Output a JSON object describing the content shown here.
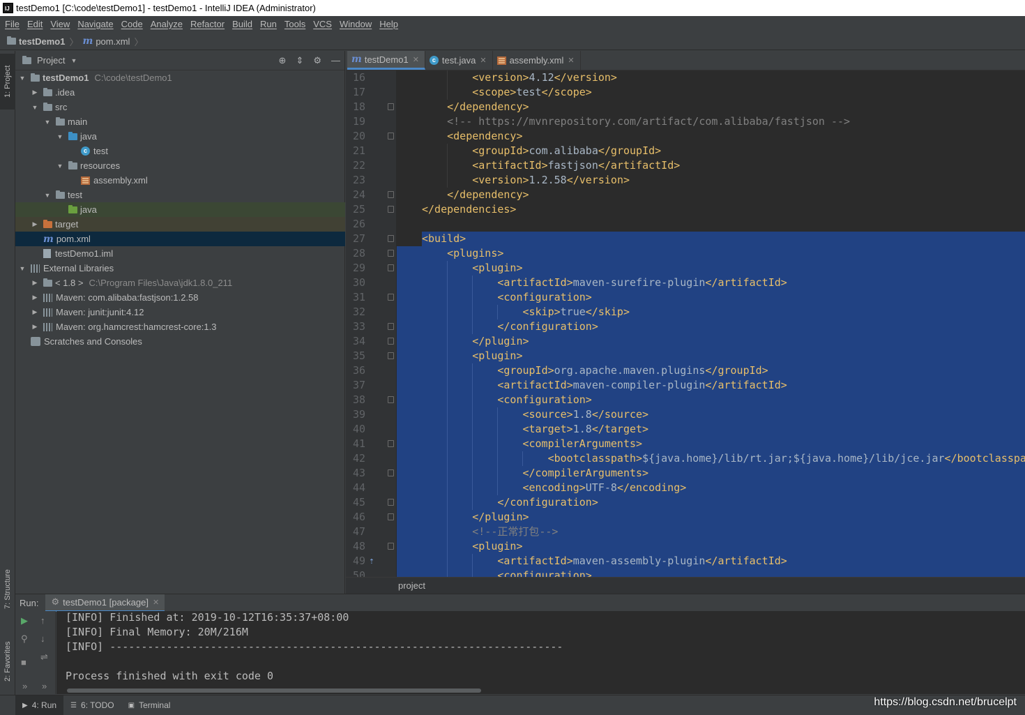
{
  "window": {
    "title": "testDemo1 [C:\\code\\testDemo1] - testDemo1 - IntelliJ IDEA (Administrator)",
    "app_icon": "IJ"
  },
  "menu": [
    "File",
    "Edit",
    "View",
    "Navigate",
    "Code",
    "Analyze",
    "Refactor",
    "Build",
    "Run",
    "Tools",
    "VCS",
    "Window",
    "Help"
  ],
  "breadcrumb": {
    "project": "testDemo1",
    "file": "pom.xml",
    "file_icon": "m"
  },
  "left_stripe": {
    "project_tab": "1: Project",
    "structure_tab": "7: Structure",
    "favorites_tab": "2: Favorites"
  },
  "project_panel": {
    "title": "Project",
    "tree": [
      {
        "label": "testDemo1",
        "extra": "C:\\code\\testDemo1",
        "arrow": "▼",
        "icon": "folder"
      },
      {
        "label": ".idea",
        "arrow": "▶",
        "icon": "folder"
      },
      {
        "label": "src",
        "arrow": "▼",
        "icon": "folder"
      },
      {
        "label": "main",
        "arrow": "▼",
        "icon": "folder"
      },
      {
        "label": "java",
        "arrow": "▼",
        "icon": "folder-blue"
      },
      {
        "label": "test",
        "arrow": "",
        "icon": "java-class"
      },
      {
        "label": "resources",
        "arrow": "▼",
        "icon": "folder-res"
      },
      {
        "label": "assembly.xml",
        "arrow": "",
        "icon": "xml"
      },
      {
        "label": "test",
        "arrow": "▼",
        "icon": "folder"
      },
      {
        "label": "java",
        "arrow": "",
        "icon": "folder-green"
      },
      {
        "label": "target",
        "arrow": "▶",
        "icon": "folder-orange"
      },
      {
        "label": "pom.xml",
        "arrow": "",
        "icon": "maven"
      },
      {
        "label": "testDemo1.iml",
        "arrow": "",
        "icon": "iml"
      },
      {
        "label": "External Libraries",
        "arrow": "▼",
        "icon": "lib"
      },
      {
        "label": "< 1.8 >",
        "extra": "C:\\Program Files\\Java\\jdk1.8.0_211",
        "arrow": "▶",
        "icon": "folder"
      },
      {
        "label": "Maven: com.alibaba:fastjson:1.2.58",
        "arrow": "▶",
        "icon": "lib"
      },
      {
        "label": "Maven: junit:junit:4.12",
        "arrow": "▶",
        "icon": "lib"
      },
      {
        "label": "Maven: org.hamcrest:hamcrest-core:1.3",
        "arrow": "▶",
        "icon": "lib"
      },
      {
        "label": "Scratches and Consoles",
        "arrow": "",
        "icon": "scratch"
      }
    ]
  },
  "editor_tabs": [
    {
      "label": "testDemo1",
      "icon": "m",
      "active": true
    },
    {
      "label": "test.java",
      "icon": "java-class",
      "active": false
    },
    {
      "label": "assembly.xml",
      "icon": "xml",
      "active": false
    }
  ],
  "code_lines": [
    {
      "n": "16",
      "indent": 2,
      "kind": "tag",
      "open": "version",
      "value": "4.12",
      "sel": false,
      "fold": false
    },
    {
      "n": "17",
      "indent": 2,
      "kind": "tag",
      "open": "scope",
      "value": "test",
      "sel": false,
      "fold": false
    },
    {
      "n": "18",
      "indent": 1,
      "kind": "close",
      "open": "dependency",
      "sel": false,
      "fold": true
    },
    {
      "n": "19",
      "indent": 1,
      "kind": "comment",
      "value": "<!-- https://mvnrepository.com/artifact/com.alibaba/fastjson -->",
      "sel": false,
      "fold": false
    },
    {
      "n": "20",
      "indent": 1,
      "kind": "open",
      "open": "dependency",
      "sel": false,
      "fold": true
    },
    {
      "n": "21",
      "indent": 2,
      "kind": "tag",
      "open": "groupId",
      "value": "com.alibaba",
      "sel": false,
      "fold": false
    },
    {
      "n": "22",
      "indent": 2,
      "kind": "tag",
      "open": "artifactId",
      "value": "fastjson",
      "sel": false,
      "fold": false
    },
    {
      "n": "23",
      "indent": 2,
      "kind": "tag",
      "open": "version",
      "value": "1.2.58",
      "sel": false,
      "fold": false
    },
    {
      "n": "24",
      "indent": 1,
      "kind": "close",
      "open": "dependency",
      "sel": false,
      "fold": true
    },
    {
      "n": "25",
      "indent": 0,
      "kind": "close",
      "open": "dependencies",
      "sel": false,
      "fold": true
    },
    {
      "n": "26",
      "indent": 0,
      "kind": "blank",
      "sel": false,
      "fold": false
    },
    {
      "n": "27",
      "indent": 0,
      "kind": "open",
      "open": "build",
      "sel": true,
      "fold": true
    },
    {
      "n": "28",
      "indent": 1,
      "kind": "open",
      "open": "plugins",
      "sel": true,
      "fold": true
    },
    {
      "n": "29",
      "indent": 2,
      "kind": "open",
      "open": "plugin",
      "sel": true,
      "fold": true
    },
    {
      "n": "30",
      "indent": 3,
      "kind": "tag",
      "open": "artifactId",
      "value": "maven-surefire-plugin",
      "sel": true,
      "fold": false
    },
    {
      "n": "31",
      "indent": 3,
      "kind": "open",
      "open": "configuration",
      "sel": true,
      "fold": true
    },
    {
      "n": "32",
      "indent": 4,
      "kind": "tag",
      "open": "skip",
      "value": "true",
      "sel": true,
      "fold": false
    },
    {
      "n": "33",
      "indent": 3,
      "kind": "close",
      "open": "configuration",
      "sel": true,
      "fold": true
    },
    {
      "n": "34",
      "indent": 2,
      "kind": "close",
      "open": "plugin",
      "sel": true,
      "fold": true
    },
    {
      "n": "35",
      "indent": 2,
      "kind": "open",
      "open": "plugin",
      "sel": true,
      "fold": true
    },
    {
      "n": "36",
      "indent": 3,
      "kind": "tag",
      "open": "groupId",
      "value": "org.apache.maven.plugins",
      "sel": true,
      "fold": false
    },
    {
      "n": "37",
      "indent": 3,
      "kind": "tag",
      "open": "artifactId",
      "value": "maven-compiler-plugin",
      "sel": true,
      "fold": false
    },
    {
      "n": "38",
      "indent": 3,
      "kind": "open",
      "open": "configuration",
      "sel": true,
      "fold": true
    },
    {
      "n": "39",
      "indent": 4,
      "kind": "tag",
      "open": "source",
      "value": "1.8",
      "sel": true,
      "fold": false
    },
    {
      "n": "40",
      "indent": 4,
      "kind": "tag",
      "open": "target",
      "value": "1.8",
      "sel": true,
      "fold": false
    },
    {
      "n": "41",
      "indent": 4,
      "kind": "open",
      "open": "compilerArguments",
      "sel": true,
      "fold": true
    },
    {
      "n": "42",
      "indent": 5,
      "kind": "tag-trunc",
      "open": "bootclasspath",
      "value": "${java.home}/lib/rt.jar;${java.home}/lib/jce.jar",
      "tail": "</bootclasspa",
      "sel": true,
      "fold": false
    },
    {
      "n": "43",
      "indent": 4,
      "kind": "close",
      "open": "compilerArguments",
      "sel": true,
      "fold": true
    },
    {
      "n": "44",
      "indent": 4,
      "kind": "tag",
      "open": "encoding",
      "value": "UTF-8",
      "sel": true,
      "fold": false
    },
    {
      "n": "45",
      "indent": 3,
      "kind": "close",
      "open": "configuration",
      "sel": true,
      "fold": true
    },
    {
      "n": "46",
      "indent": 2,
      "kind": "close",
      "open": "plugin",
      "sel": true,
      "fold": true
    },
    {
      "n": "47",
      "indent": 2,
      "kind": "comment",
      "value": "<!--正常打包-->",
      "sel": true,
      "fold": false
    },
    {
      "n": "48",
      "indent": 2,
      "kind": "open",
      "open": "plugin",
      "sel": true,
      "fold": true
    },
    {
      "n": "49",
      "indent": 3,
      "kind": "tag",
      "open": "artifactId",
      "value": "maven-assembly-plugin",
      "sel": true,
      "fold": false,
      "marker": true
    },
    {
      "n": "50",
      "indent": 3,
      "kind": "open",
      "open": "configuration",
      "sel": true,
      "fold": false
    }
  ],
  "editor_breadcrumb": "project",
  "run_panel": {
    "label": "Run:",
    "tab": "testDemo1 [package]",
    "console": [
      "[INFO] Finished at: 2019-10-12T16:35:37+08:00",
      "[INFO] Final Memory: 20M/216M",
      "[INFO] ------------------------------------------------------------------------",
      "",
      "Process finished with exit code 0"
    ]
  },
  "status_tabs": [
    {
      "label": "4: Run",
      "icon": "▶",
      "active": true
    },
    {
      "label": "6: TODO",
      "icon": "☰",
      "active": false
    },
    {
      "label": "Terminal",
      "icon": "▣",
      "active": false
    }
  ],
  "watermark": "https://blog.csdn.net/brucelpt"
}
